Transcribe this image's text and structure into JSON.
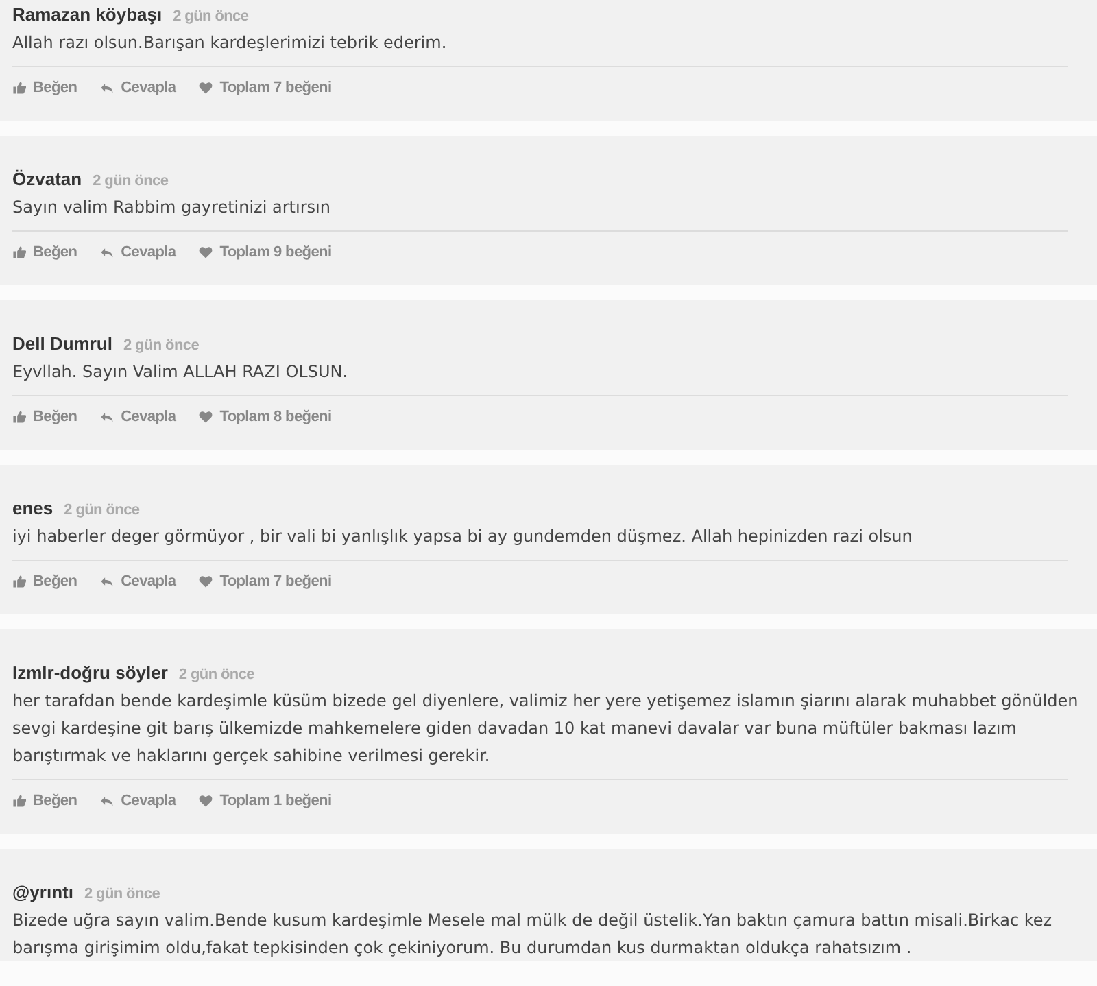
{
  "comments": [
    {
      "author": "Ramazan köybaşı",
      "time": "2 gün önce",
      "text": "Allah razı olsun.Barışan kardeşlerimizi tebrik ederim.",
      "actions": {
        "like": "Beğen",
        "reply": "Cevapla",
        "total": "Toplam 7 beğeni"
      }
    },
    {
      "author": "Özvatan",
      "time": "2 gün önce",
      "text": "Sayın valim Rabbim gayretinizi artırsın",
      "actions": {
        "like": "Beğen",
        "reply": "Cevapla",
        "total": "Toplam 9 beğeni"
      }
    },
    {
      "author": "Dell Dumrul",
      "time": "2 gün önce",
      "text": "Eyvllah. Sayın Valim ALLAH RAZI OLSUN.",
      "actions": {
        "like": "Beğen",
        "reply": "Cevapla",
        "total": "Toplam 8 beğeni"
      }
    },
    {
      "author": "enes",
      "time": "2 gün önce",
      "text": "iyi haberler deger görmüyor , bir vali bi yanlışlık yapsa bi ay gundemden düşmez. Allah hepinizden razi olsun",
      "actions": {
        "like": "Beğen",
        "reply": "Cevapla",
        "total": "Toplam 7 beğeni"
      }
    },
    {
      "author": "Izmlr-doğru söyler",
      "time": "2 gün önce",
      "text": "her tarafdan bende kardeşimle küsüm bizede gel diyenlere, valimiz her yere yetişemez islamın şiarını alarak muhabbet gönülden sevgi kardeşine git barış ülkemizde mahkemelere giden davadan 10 kat manevi davalar var buna müftüler bakması lazım barıştırmak ve haklarını gerçek sahibine verilmesi gerekir.",
      "actions": {
        "like": "Beğen",
        "reply": "Cevapla",
        "total": "Toplam 1 beğeni"
      }
    },
    {
      "author": "@yrıntı",
      "time": "2 gün önce",
      "text": "Bizede uğra sayın valim.Bende kusum kardeşimle Mesele mal mülk de değil üstelik.Yan baktın çamura battın misali.Birkac kez barışma girişimim oldu,fakat tepkisinden çok çekiniyorum. Bu durumdan kus durmaktan oldukça rahatsızım ."
    }
  ]
}
